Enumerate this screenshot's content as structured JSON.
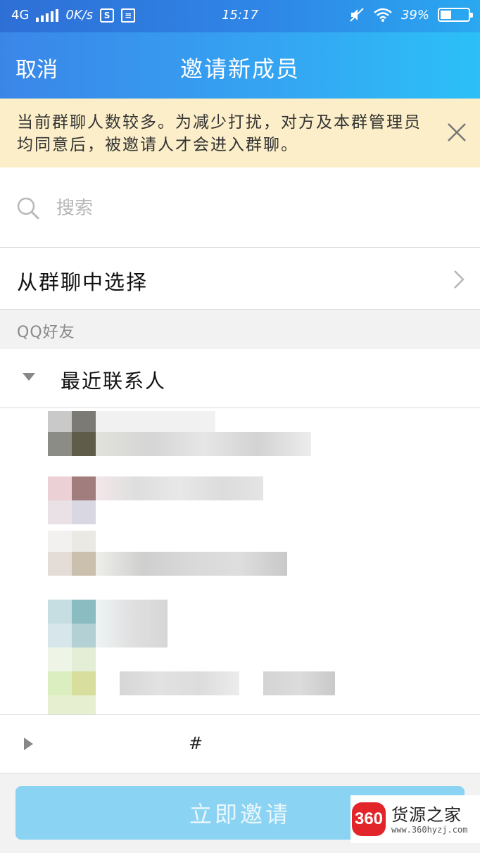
{
  "status_bar": {
    "network": "4G",
    "speed": "0K/s",
    "time": "15:17",
    "battery": "39%",
    "battery_level": 0.39
  },
  "header": {
    "cancel_label": "取消",
    "title": "邀请新成员"
  },
  "notice": {
    "text": "当前群聊人数较多。为减少打扰，对方及本群管理员均同意后，被邀请人才会进入群聊。",
    "background": "#fbeec8"
  },
  "search": {
    "placeholder": "搜索",
    "value": ""
  },
  "from_group": {
    "label": "从群聊中选择"
  },
  "friends_section": {
    "header": "QQ好友",
    "groups": [
      {
        "name": "最近联系人",
        "expanded": true
      },
      {
        "name": "#",
        "expanded": false
      }
    ]
  },
  "footer": {
    "invite_label": "立即邀请",
    "button_color": "#8bd3f2"
  },
  "watermark": {
    "badge": "360",
    "name": "货源之家",
    "url": "www.360hyzj.com"
  },
  "theme": {
    "header_gradient_start": "#3a86e8",
    "header_gradient_end": "#2cc0f7"
  }
}
